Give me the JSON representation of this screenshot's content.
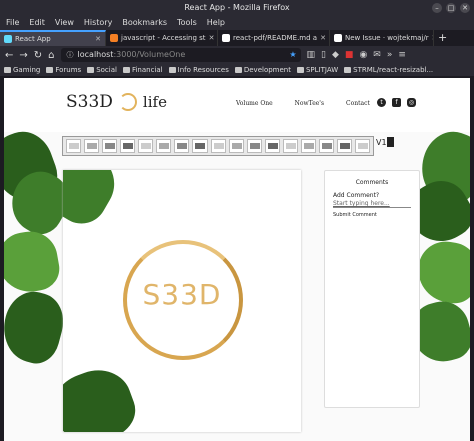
{
  "window": {
    "title": "React App - Mozilla Firefox",
    "controls": [
      "–",
      "□",
      "✕"
    ]
  },
  "menu": {
    "items": [
      "File",
      "Edit",
      "View",
      "History",
      "Bookmarks",
      "Tools",
      "Help"
    ]
  },
  "tabs": [
    {
      "label": "React App",
      "color": "#61dafb"
    },
    {
      "label": "javascript - Accessing st",
      "color": "#f48024"
    },
    {
      "label": "react-pdf/README.md a",
      "color": "#ffffff"
    },
    {
      "label": "New Issue · wojtekmaj/r",
      "color": "#ffffff"
    }
  ],
  "tabs_extra": "+",
  "nav": {
    "url_host": "localhost",
    "url_rest": ":3000/VolumeOne",
    "icons": [
      "back-icon",
      "forward-icon",
      "reload-icon",
      "home-icon"
    ]
  },
  "bookmarks": [
    "Gaming",
    "Forums",
    "Social",
    "Financial",
    "Info Resources",
    "Development",
    "SPLITJAW",
    "STRML/react-resizabl..."
  ],
  "site": {
    "logo_text": "S33D",
    "logo_life": "life",
    "nav_links": [
      "Volume One",
      "NowTee's",
      "Contact"
    ],
    "doc_title": "S33D",
    "version_label": "V1",
    "thumb_count": 17
  },
  "comments": {
    "title": "Comments",
    "add_label": "Add Comment?",
    "placeholder": "Start typing here...",
    "submit_label": "Submit Comment"
  }
}
